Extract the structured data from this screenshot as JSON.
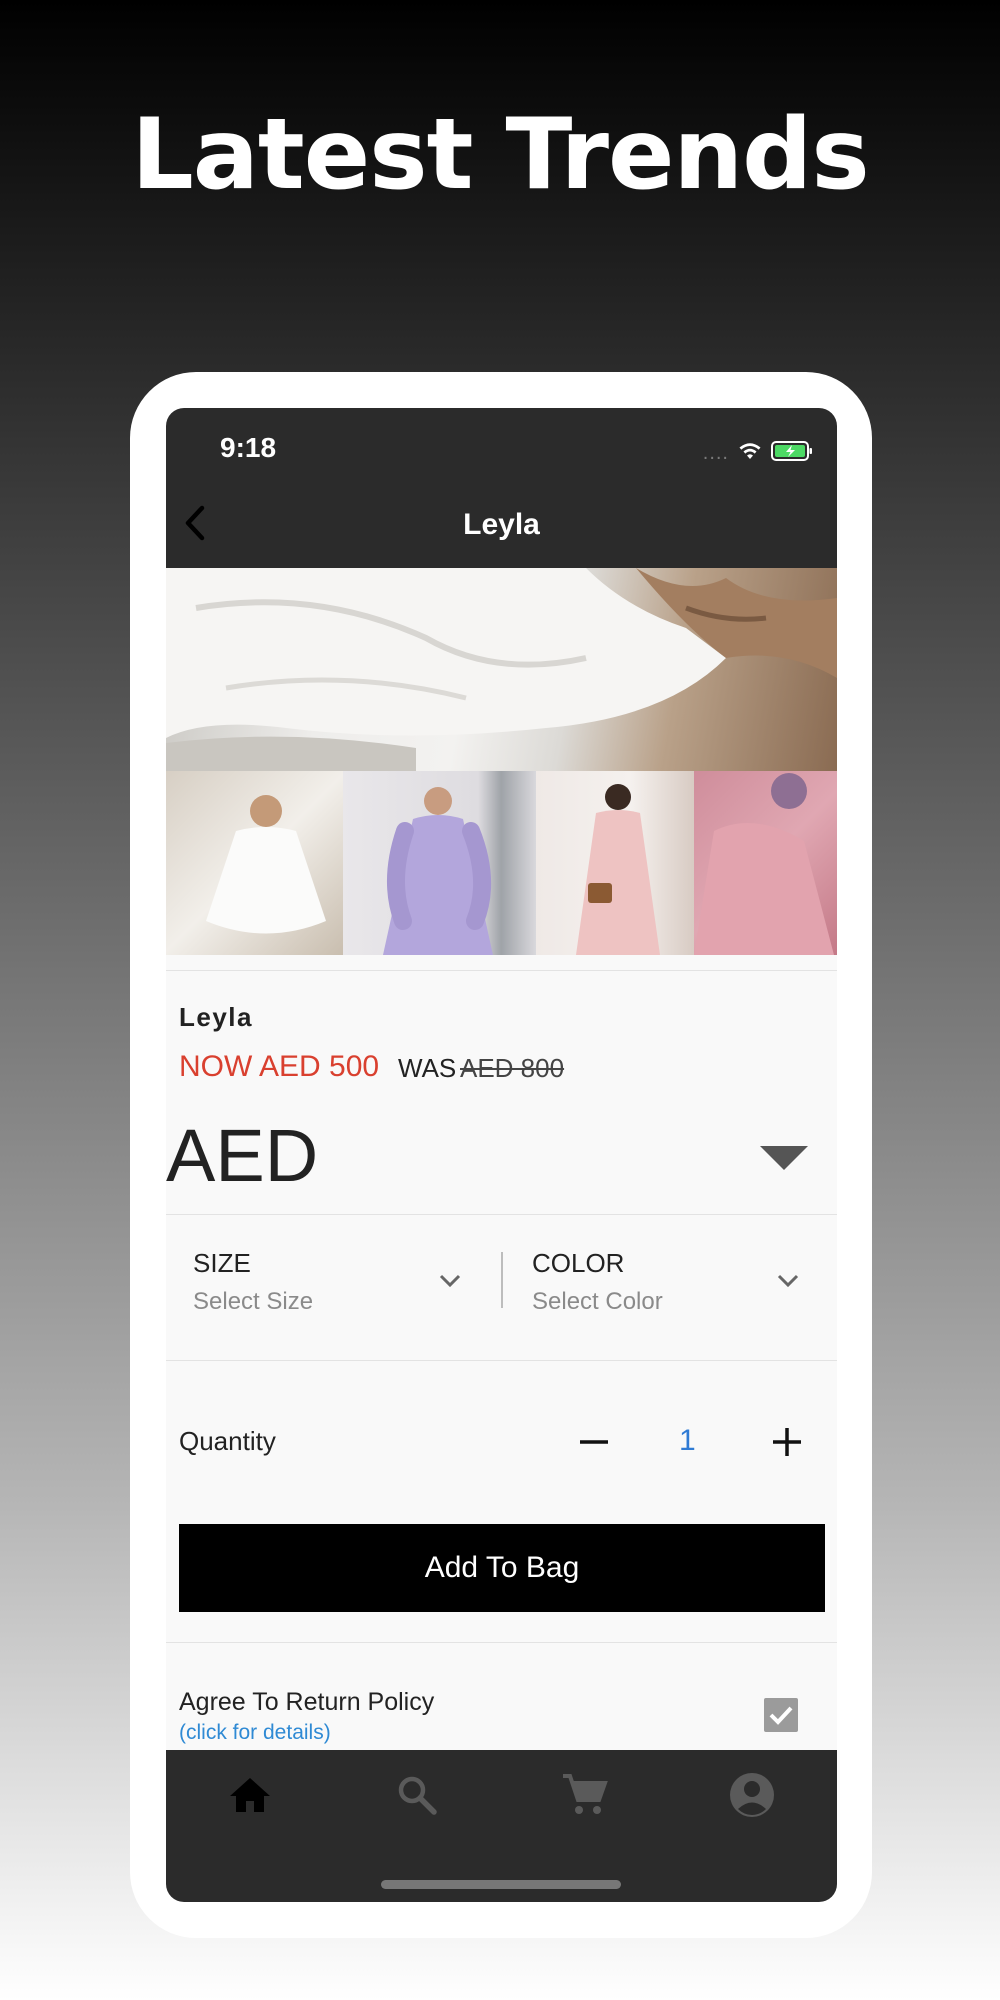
{
  "headline": "Latest Trends",
  "status": {
    "time": "9:18",
    "dots": "...."
  },
  "nav": {
    "title": "Leyla",
    "back_icon": "chevron-left-icon"
  },
  "product": {
    "name": "Leyla",
    "price_now": "NOW AED 500",
    "price_was_label": "WAS",
    "price_was": "AED 800",
    "currency": "AED"
  },
  "selectors": {
    "size_label": "SIZE",
    "size_placeholder": "Select Size",
    "color_label": "COLOR",
    "color_placeholder": "Select Color"
  },
  "quantity": {
    "label": "Quantity",
    "value": "1"
  },
  "add_to_bag": "Add To Bag",
  "return_policy": {
    "label": "Agree To Return Policy",
    "link": "(click for details)",
    "checked": true
  },
  "tabs": [
    {
      "name": "home",
      "icon": "home-icon",
      "active": true
    },
    {
      "name": "search",
      "icon": "search-icon",
      "active": false
    },
    {
      "name": "cart",
      "icon": "cart-icon",
      "active": false
    },
    {
      "name": "account",
      "icon": "account-icon",
      "active": false
    }
  ],
  "colors": {
    "accent_price": "#d9402f",
    "qty": "#2f7bd4",
    "link": "#2f8ad4",
    "bar": "#2b2b2b"
  }
}
